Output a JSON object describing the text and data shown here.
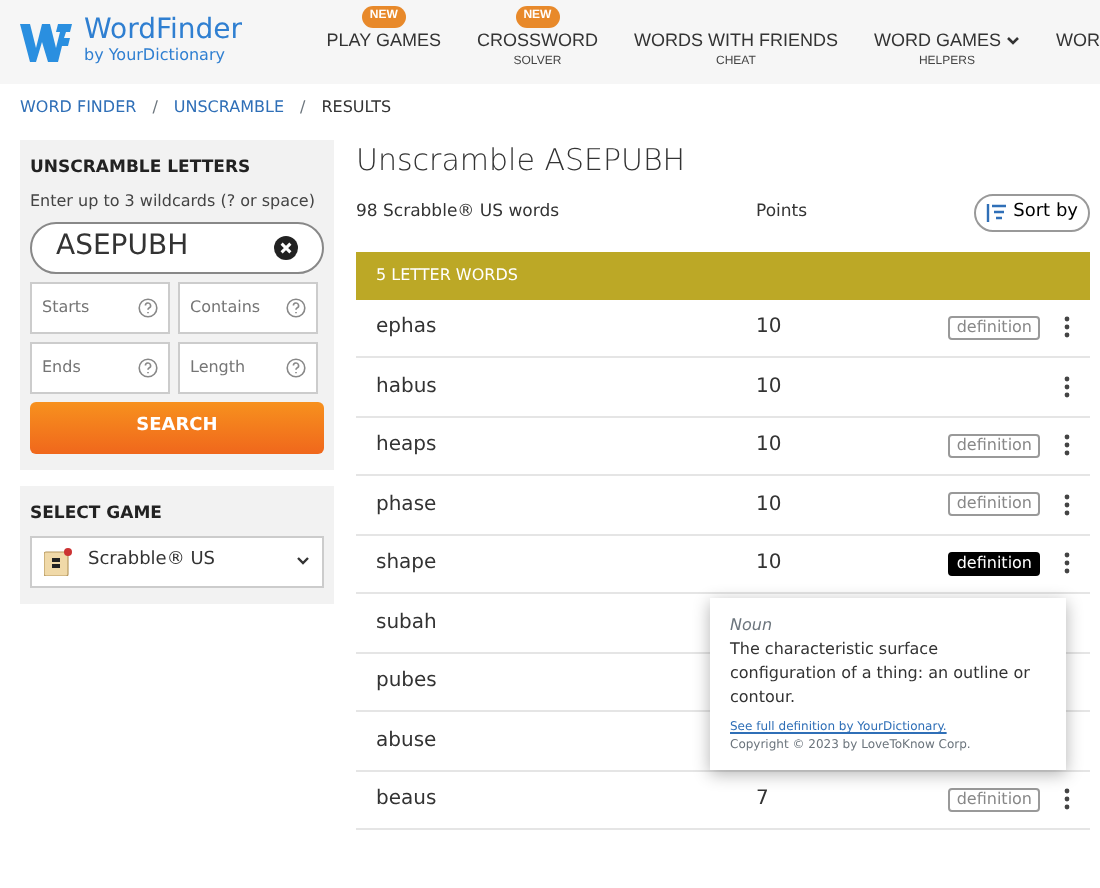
{
  "logo": {
    "name": "WordFinder",
    "byline": "by YourDictionary"
  },
  "nav": [
    {
      "label": "PLAY GAMES",
      "badge": "NEW"
    },
    {
      "label": "CROSSWORD",
      "sub": "SOLVER",
      "badge": "NEW"
    },
    {
      "label": "WORDS WITH FRIENDS",
      "sub": "CHEAT"
    },
    {
      "label": "WORD GAMES",
      "sub": "HELPERS",
      "dropdown": true
    },
    {
      "label": "WOR"
    }
  ],
  "breadcrumb": [
    {
      "label": "WORD FINDER",
      "kind": "link"
    },
    {
      "label": "/",
      "kind": "separator"
    },
    {
      "label": "UNSCRAMBLE",
      "kind": "link"
    },
    {
      "label": "/",
      "kind": "separator"
    },
    {
      "label": "RESULTS",
      "kind": "current"
    }
  ],
  "unscramble": {
    "title": "UNSCRAMBLE LETTERS",
    "hint": "Enter up to 3 wildcards (? or space)",
    "value": "ASEPUBH",
    "filters": [
      {
        "placeholder": "Starts"
      },
      {
        "placeholder": "Contains"
      },
      {
        "placeholder": "Ends"
      },
      {
        "placeholder": "Length"
      }
    ],
    "button": "SEARCH"
  },
  "select_game": {
    "title": "SELECT GAME",
    "value": "Scrabble® US"
  },
  "results": {
    "title": "Unscramble ASEPUBH",
    "count": "98 Scrabble® US words",
    "points_header": "Points",
    "sort": "Sort by",
    "group": "5 LETTER WORDS",
    "rows": [
      {
        "word": "ephas",
        "points": "10",
        "definition": {
          "label": "definition",
          "selected": false
        },
        "menu": true
      },
      {
        "word": "habus",
        "points": "10",
        "menu": true
      },
      {
        "word": "heaps",
        "points": "10",
        "definition": {
          "label": "definition",
          "selected": false
        },
        "menu": true
      },
      {
        "word": "phase",
        "points": "10",
        "definition": {
          "label": "definition",
          "selected": false
        },
        "menu": true
      },
      {
        "word": "shape",
        "points": "10",
        "definition": {
          "label": "definition",
          "selected": true
        },
        "menu": true
      },
      {
        "word": "subah"
      },
      {
        "word": "pubes"
      },
      {
        "word": "abuse"
      },
      {
        "word": "beaus",
        "points": "7",
        "definition": {
          "label": "definition",
          "selected": false
        },
        "menu": true
      }
    ]
  },
  "popup": {
    "pos": "Noun",
    "text": "The characteristic surface configuration of a thing: an outline or contour.",
    "link": "See full definition by YourDictionary.",
    "copyright": "Copyright © 2023 by LoveToKnow Corp."
  }
}
